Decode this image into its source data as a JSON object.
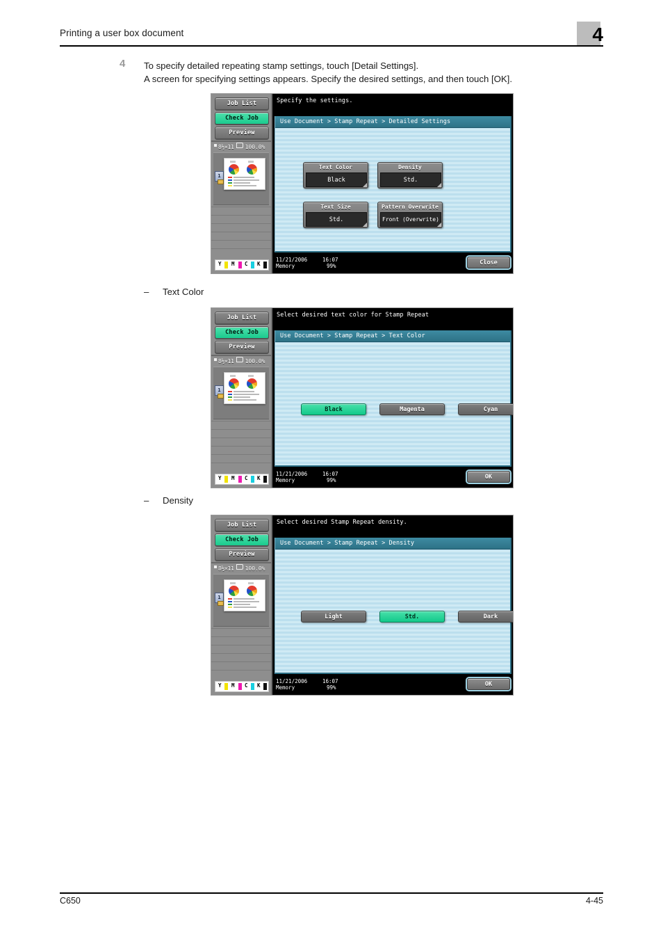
{
  "header": {
    "title": "Printing a user box document",
    "chapter": "4"
  },
  "step": {
    "number": "4",
    "line1": "To specify detailed repeating stamp settings, touch [Detail Settings].",
    "line2": "A screen for specifying settings appears. Specify the desired settings, and then touch [OK]."
  },
  "sub_labels": {
    "dash": "–",
    "text_color": "Text Color",
    "density": "Density"
  },
  "footer": {
    "model": "C650",
    "page": "4-45"
  },
  "common": {
    "rail": {
      "job_list": "Job List",
      "check_job": "Check Job",
      "preview": "Preview",
      "paper_square": "",
      "paper_size": "8½×11",
      "zoom": "100.0%",
      "page_badge": "1",
      "toner": [
        {
          "label": "Y",
          "color": "#f2e300"
        },
        {
          "label": "M",
          "color": "#ef18b0"
        },
        {
          "label": "C",
          "color": "#18cfe0"
        },
        {
          "label": "K",
          "color": "#101010"
        }
      ]
    },
    "status": {
      "date": "11/21/2006",
      "time": "16:07",
      "memory_label": "Memory",
      "memory_value": "99%"
    },
    "colors": {
      "accent_green": "#17c98c",
      "crumb_blue": "#2d7286",
      "work_bg": "#cfeaf4"
    }
  },
  "panels": [
    {
      "id": "detailed-settings",
      "message": "Specify the settings.",
      "breadcrumb": "Use Document > Stamp Repeat > Detailed Settings",
      "setting_buttons": [
        {
          "caption": "Text Color",
          "value": "Black"
        },
        {
          "caption": "Density",
          "value": "Std."
        },
        {
          "caption": "Text Size",
          "value": "Std."
        },
        {
          "caption": "Pattern Overwrite",
          "value": "Front (Overwrite)"
        }
      ],
      "action_button": "Close"
    },
    {
      "id": "text-color",
      "message": "Select desired text color for Stamp Repeat",
      "breadcrumb": "Use Document > Stamp Repeat > Text Color",
      "options": [
        {
          "label": "Black",
          "selected": true
        },
        {
          "label": "Magenta",
          "selected": false
        },
        {
          "label": "Cyan",
          "selected": false
        }
      ],
      "action_button": "OK"
    },
    {
      "id": "density",
      "message": "Select desired Stamp Repeat density.",
      "breadcrumb": "Use Document > Stamp Repeat > Density",
      "options": [
        {
          "label": "Light",
          "selected": false
        },
        {
          "label": "Std.",
          "selected": true
        },
        {
          "label": "Dark",
          "selected": false
        }
      ],
      "action_button": "OK"
    }
  ]
}
